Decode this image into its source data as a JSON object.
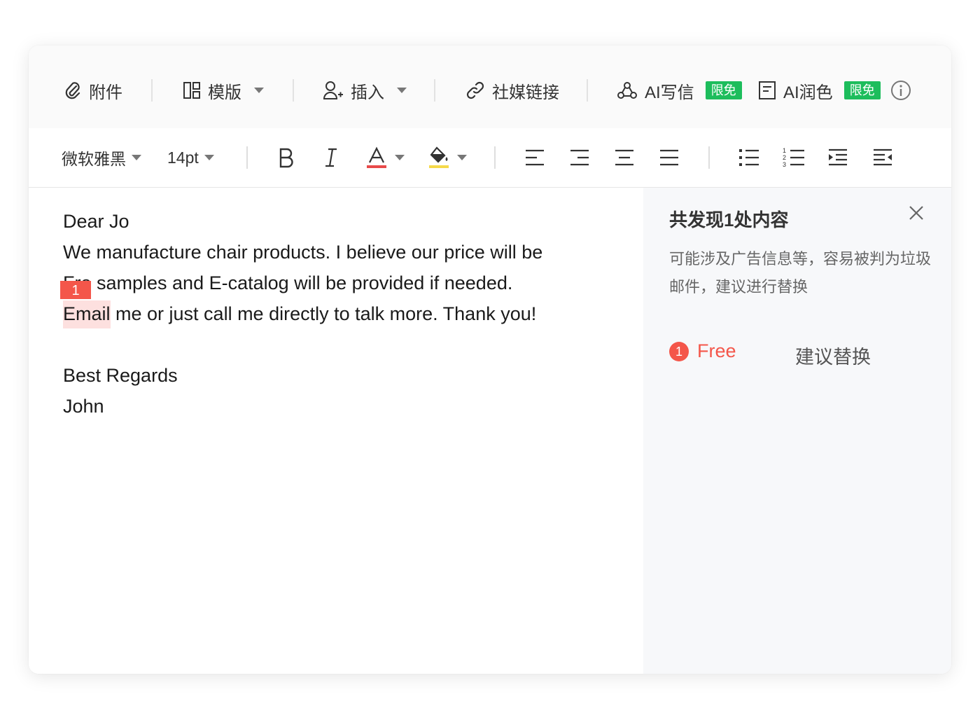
{
  "toolbar_top": {
    "attach": "附件",
    "template": "模版",
    "insert": "插入",
    "social": "社媒链接",
    "ai_write": "AI写信",
    "ai_write_badge": "限免",
    "ai_polish": "AI润色",
    "ai_polish_badge": "限免"
  },
  "toolbar_format": {
    "font": "微软雅黑",
    "size": "14pt",
    "text_color": "#e84a4a",
    "highlight_color": "#f5d94a"
  },
  "editor": {
    "lines": [
      "Dear Jo",
      "We manufacture chair products. I believe our price will be",
      "Free samples and E-catalog will be provided if needed.",
      "Email me or just call me directly to talk more. Thank you!",
      "",
      "Best Regards",
      "John"
    ],
    "line3_rest": "e samples and E-catalog will be provided if needed.",
    "line3_prefix": "Fr",
    "line4_highlight": "Email",
    "line4_rest": " me or just call me directly to talk more. Thank you!",
    "marker": "1"
  },
  "panel": {
    "title": "共发现1处内容",
    "description": "可能涉及广告信息等，容易被判为垃圾邮件，建议进行替换",
    "issue_number": "1",
    "issue_word": "Free",
    "issue_action": "建议替换",
    "accent": "#f4564a"
  },
  "colors": {
    "badge": "#1dbd5c"
  }
}
